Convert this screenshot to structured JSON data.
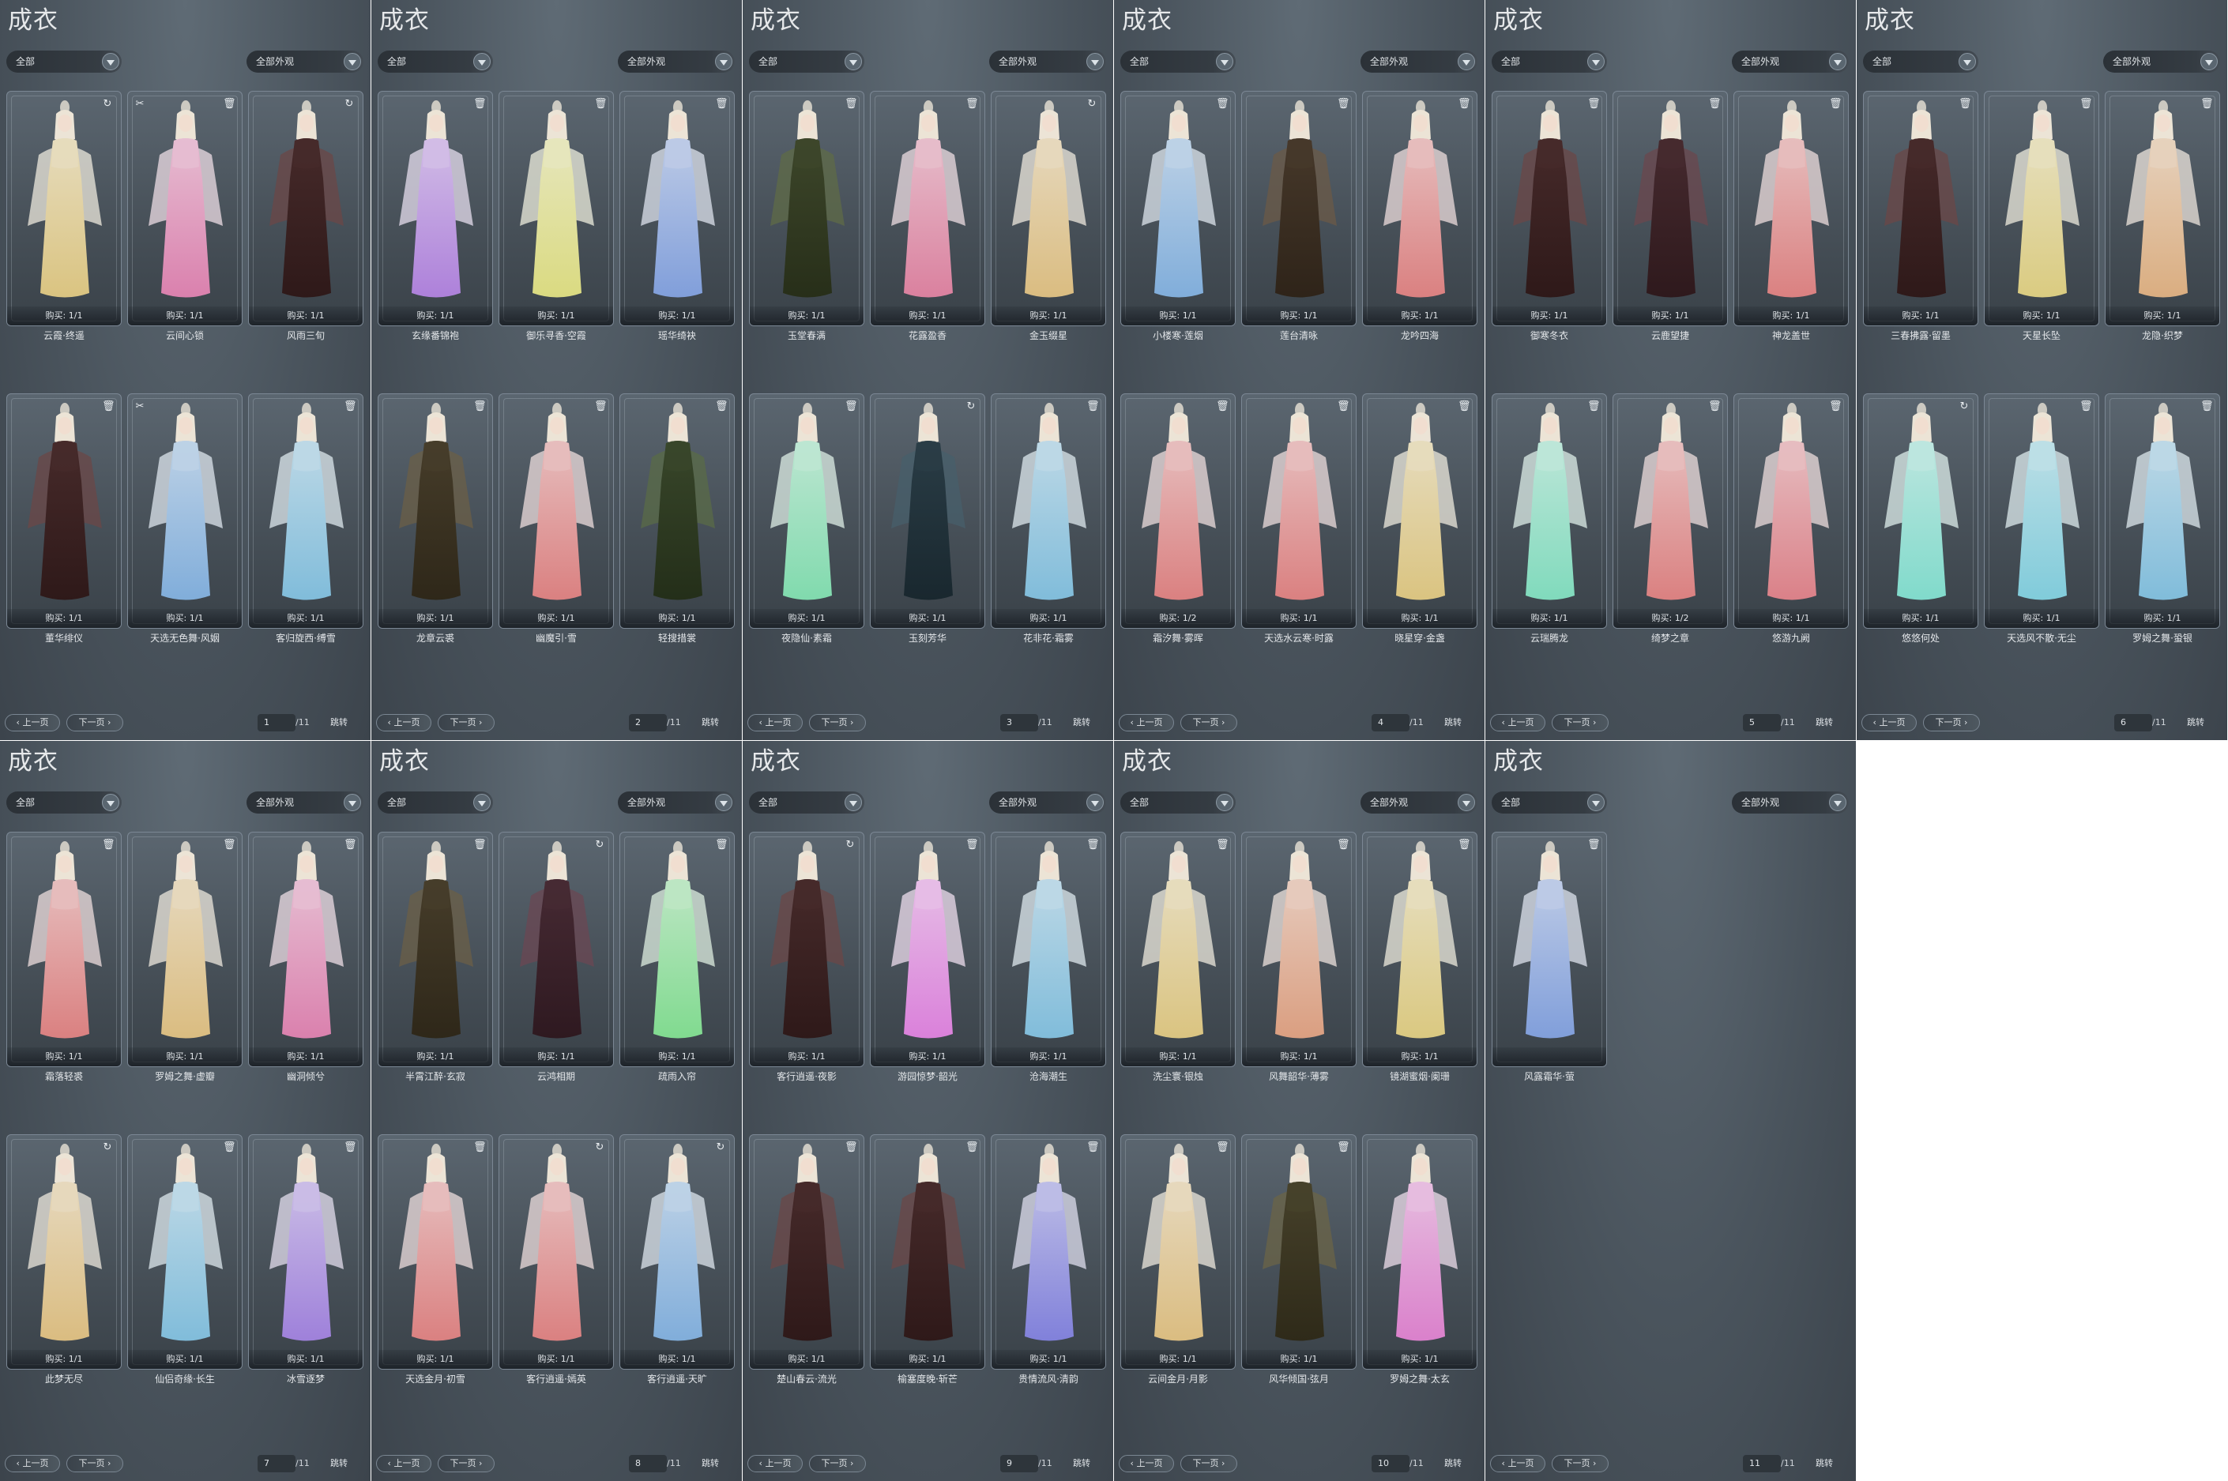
{
  "panel_title": "成衣",
  "filter_all": "全部",
  "filter_appearance": "全部外观",
  "prev_label": "上一页",
  "next_label": "下一页",
  "jump_label": "跳转",
  "total_pages": "/11",
  "panels": [
    {
      "page": "1",
      "items": [
        {
          "name": "云霞·终遥",
          "buy": "购买: 1/1",
          "icon": "↻",
          "hue": 45
        },
        {
          "name": "云间心锁",
          "buy": "购买: 1/1",
          "icon": "🗑",
          "left_icon": "✂",
          "hue": 330
        },
        {
          "name": "风雨三旬",
          "buy": "购买: 1/1",
          "icon": "↻",
          "hue": 0,
          "dark": true
        },
        {
          "name": "董华绯仪",
          "buy": "购买: 1/1",
          "icon": "🗑",
          "hue": 0,
          "dark": true
        },
        {
          "name": "天选无色舞·风姻",
          "buy": "购买: 1/1",
          "icon": "",
          "left_icon": "✂",
          "hue": 210
        },
        {
          "name": "客归旋西·缚雪",
          "buy": "购买: 1/1",
          "icon": "🗑",
          "hue": 200
        }
      ]
    },
    {
      "page": "2",
      "items": [
        {
          "name": "玄缘番锦袍",
          "buy": "购买: 1/1",
          "icon": "🗑",
          "hue": 270
        },
        {
          "name": "御乐寻香·空霞",
          "buy": "购买: 1/1",
          "icon": "🗑",
          "hue": 60
        },
        {
          "name": "瑶华绮袂",
          "buy": "购买: 1/1",
          "icon": "🗑",
          "hue": 220
        },
        {
          "name": "龙章云裘",
          "buy": "购买: 1/1",
          "icon": "🗑",
          "hue": 40,
          "dark": true
        },
        {
          "name": "幽魔引·雪",
          "buy": "购买: 1/1",
          "icon": "🗑",
          "hue": 0
        },
        {
          "name": "轻搜措裳",
          "buy": "购买: 1/1",
          "icon": "🗑",
          "hue": 90,
          "dark": true
        }
      ]
    },
    {
      "page": "3",
      "items": [
        {
          "name": "玉堂春满",
          "buy": "购买: 1/1",
          "icon": "🗑",
          "hue": 80,
          "dark": true
        },
        {
          "name": "花露盈香",
          "buy": "购买: 1/1",
          "icon": "🗑",
          "hue": 340
        },
        {
          "name": "金玉缀星",
          "buy": "购买: 1/1",
          "icon": "↻",
          "hue": 40
        },
        {
          "name": "夜隐仙·素霜",
          "buy": "购买: 1/1",
          "icon": "🗑",
          "hue": 150
        },
        {
          "name": "玉刻芳华",
          "buy": "购买: 1/1",
          "icon": "↻",
          "hue": 200,
          "dark": true
        },
        {
          "name": "花非花·霜雾",
          "buy": "购买: 1/1",
          "icon": "🗑",
          "hue": 200
        }
      ]
    },
    {
      "page": "4",
      "items": [
        {
          "name": "小楼寒·莲烟",
          "buy": "购买: 1/1",
          "icon": "🗑",
          "hue": 210
        },
        {
          "name": "莲台清咏",
          "buy": "购买: 1/1",
          "icon": "🗑",
          "hue": 30,
          "dark": true
        },
        {
          "name": "龙吟四海",
          "buy": "购买: 1/1",
          "icon": "🗑",
          "hue": 0
        },
        {
          "name": "霜汐舞·雾晖",
          "buy": "购买: 1/2",
          "icon": "🗑",
          "hue": 0
        },
        {
          "name": "天选水云寒·时露",
          "buy": "购买: 1/1",
          "icon": "🗑",
          "hue": 0
        },
        {
          "name": "晓星穿·金盏",
          "buy": "购买: 1/1",
          "icon": "🗑",
          "hue": 45
        }
      ]
    },
    {
      "page": "5",
      "items": [
        {
          "name": "御寒冬衣",
          "buy": "购买: 1/1",
          "icon": "🗑",
          "hue": 0,
          "dark": true
        },
        {
          "name": "云鹿望捷",
          "buy": "购买: 1/1",
          "icon": "🗑",
          "hue": 350,
          "dark": true
        },
        {
          "name": "神龙盖世",
          "buy": "购买: 1/1",
          "icon": "🗑",
          "hue": 0
        },
        {
          "name": "云瑞腾龙",
          "buy": "购买: 1/1",
          "icon": "🗑",
          "hue": 160
        },
        {
          "name": "绮梦之章",
          "buy": "购买: 1/2",
          "icon": "🗑",
          "hue": 0
        },
        {
          "name": "悠游九阙",
          "buy": "购买: 1/1",
          "icon": "🗑",
          "hue": 355
        }
      ]
    },
    {
      "page": "6",
      "items": [
        {
          "name": "三春拂露·留墨",
          "buy": "购买: 1/1",
          "icon": "🗑",
          "hue": 0,
          "dark": true
        },
        {
          "name": "天星长坠",
          "buy": "购买: 1/1",
          "icon": "🗑",
          "hue": 50
        },
        {
          "name": "龙隐·织梦",
          "buy": "购买: 1/1",
          "icon": "🗑",
          "hue": 30
        },
        {
          "name": "悠悠何处",
          "buy": "购买: 1/1",
          "icon": "↻",
          "hue": 170
        },
        {
          "name": "天选风不散·无尘",
          "buy": "购买: 1/1",
          "icon": "🗑",
          "hue": 190
        },
        {
          "name": "罗姆之舞·蛩银",
          "buy": "购买: 1/1",
          "icon": "🗑",
          "hue": 200
        }
      ]
    },
    {
      "page": "7",
      "items": [
        {
          "name": "霜落轻裘",
          "buy": "购买: 1/1",
          "icon": "🗑",
          "hue": 0
        },
        {
          "name": "罗姆之舞·虚瓣",
          "buy": "购买: 1/1",
          "icon": "🗑",
          "hue": 40
        },
        {
          "name": "幽洞倾兮",
          "buy": "购买: 1/1",
          "icon": "🗑",
          "hue": 330
        },
        {
          "name": "此梦无尽",
          "buy": "购买: 1/1",
          "icon": "↻",
          "hue": 40
        },
        {
          "name": "仙侣奇缘·长生",
          "buy": "购买: 1/1",
          "icon": "🗑",
          "hue": 200
        },
        {
          "name": "冰雪逐梦",
          "buy": "购买: 1/1",
          "icon": "🗑",
          "hue": 260
        }
      ]
    },
    {
      "page": "8",
      "items": [
        {
          "name": "半霄江醉·玄寂",
          "buy": "购买: 1/1",
          "icon": "🗑",
          "hue": 40,
          "dark": true
        },
        {
          "name": "云鸿相期",
          "buy": "购买: 1/1",
          "icon": "↻",
          "hue": 340,
          "dark": true
        },
        {
          "name": "疏雨入帘",
          "buy": "购买: 1/1",
          "icon": "🗑",
          "hue": 130
        },
        {
          "name": "天选金月·初雪",
          "buy": "购买: 1/1",
          "icon": "🗑",
          "hue": 0
        },
        {
          "name": "客行逍遥·嫣英",
          "buy": "购买: 1/1",
          "icon": "↻",
          "hue": 0
        },
        {
          "name": "客行逍遥·天旷",
          "buy": "购买: 1/1",
          "icon": "↻",
          "hue": 210
        }
      ]
    },
    {
      "page": "9",
      "items": [
        {
          "name": "客行逍遥·夜影",
          "buy": "购买: 1/1",
          "icon": "↻",
          "hue": 0,
          "dark": true
        },
        {
          "name": "游园惊梦·韶光",
          "buy": "购买: 1/1",
          "icon": "🗑",
          "hue": 300
        },
        {
          "name": "沧海潮生",
          "buy": "购买: 1/1",
          "icon": "🗑",
          "hue": 200
        },
        {
          "name": "楚山春云·流光",
          "buy": "购买: 1/1",
          "icon": "🗑",
          "hue": 0,
          "dark": true
        },
        {
          "name": "榆塞度晚·斩芒",
          "buy": "购买: 1/1",
          "icon": "🗑",
          "hue": 0,
          "dark": true
        },
        {
          "name": "贵情流风·清韵",
          "buy": "购买: 1/1",
          "icon": "🗑",
          "hue": 240
        }
      ]
    },
    {
      "page": "10",
      "items": [
        {
          "name": "洗尘寰·银烛",
          "buy": "购买: 1/1",
          "icon": "🗑",
          "hue": 45
        },
        {
          "name": "风舞韶华·薄雾",
          "buy": "购买: 1/1",
          "icon": "🗑",
          "hue": 20
        },
        {
          "name": "镜湖蜜烟·阑珊",
          "buy": "购买: 1/1",
          "icon": "🗑",
          "hue": 48
        },
        {
          "name": "云间金月·月影",
          "buy": "购买: 1/1",
          "icon": "🗑",
          "hue": 40
        },
        {
          "name": "风华倾国·弦月",
          "buy": "购买: 1/1",
          "icon": "🗑",
          "hue": 48,
          "dark": true
        },
        {
          "name": "罗姆之舞·太玄",
          "buy": "购买: 1/1",
          "icon": "",
          "hue": 310
        }
      ]
    },
    {
      "page": "11",
      "items": [
        {
          "name": "风露霜华·萤",
          "buy": "",
          "icon": "🗑",
          "hue": 220
        }
      ]
    }
  ]
}
